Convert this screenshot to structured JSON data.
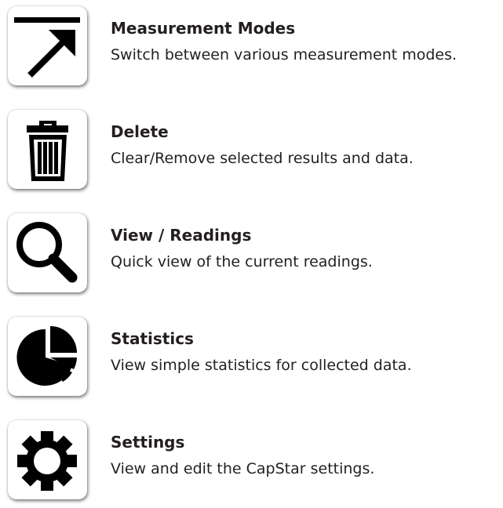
{
  "items": [
    {
      "icon": "measurement-modes-icon",
      "title": "Measurement Modes",
      "description": "Switch between various measurement modes."
    },
    {
      "icon": "trash-icon",
      "title": "Delete",
      "description": "Clear/Remove selected results and data."
    },
    {
      "icon": "magnifier-icon",
      "title": "View / Readings",
      "description": "Quick view of the current readings."
    },
    {
      "icon": "pie-chart-icon",
      "title": "Statistics",
      "description": "View simple statistics for collected data."
    },
    {
      "icon": "gear-icon",
      "title": "Settings",
      "description": "View and edit the CapStar settings."
    }
  ]
}
